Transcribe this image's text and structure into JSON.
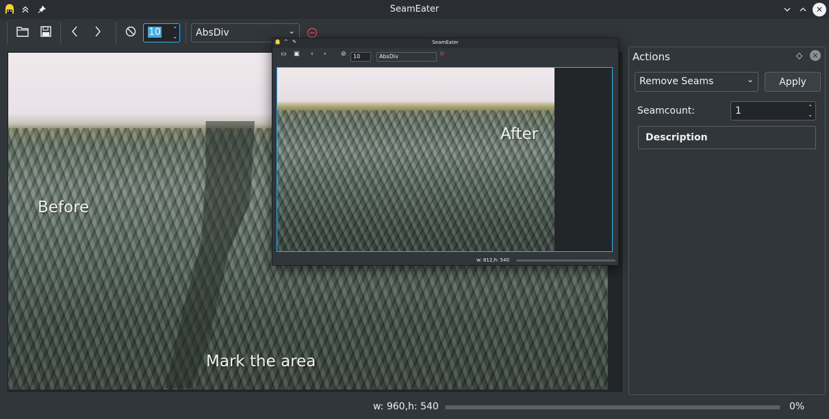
{
  "window": {
    "title": "SeamEater"
  },
  "toolbar": {
    "spin_value": "10",
    "method": "AbsDiv"
  },
  "canvas": {
    "label_before": "Before",
    "label_mark": "Mark the area"
  },
  "mini_window": {
    "title": "SeamEater",
    "spin_value": "10",
    "method": "AbsDiv",
    "label_after": "After",
    "status": "w: 812,h: 540"
  },
  "actions_panel": {
    "title": "Actions",
    "action_selected": "Remove Seams",
    "apply_label": "Apply",
    "seamcount_label": "Seamcount:",
    "seamcount_value": "1",
    "description_label": "Description"
  },
  "status": {
    "dimensions": "w: 960,h: 540",
    "progress_text": "0%",
    "progress_value": 0
  },
  "colors": {
    "accent": "#3daee9",
    "background": "#31363b",
    "stop_icon": "#da4453"
  },
  "icons": [
    "app-icon",
    "keep-above-icon",
    "pin-icon",
    "minimize-icon",
    "maximize-icon",
    "close-icon",
    "open-folder-icon",
    "save-icon",
    "back-icon",
    "forward-icon",
    "stop-icon",
    "float-icon"
  ]
}
